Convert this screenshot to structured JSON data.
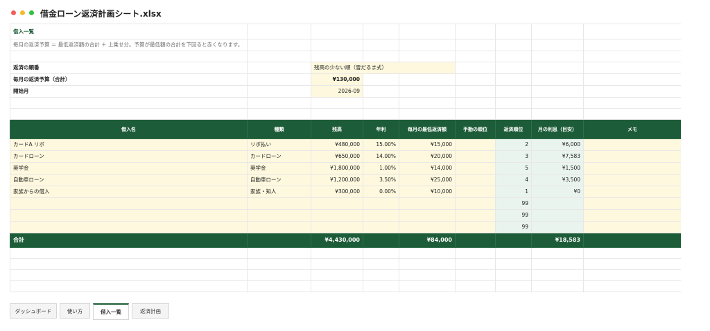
{
  "window": {
    "title": "借金ローン返済計画シート.xlsx"
  },
  "sheet": {
    "title": "借入一覧",
    "note": "毎月の返済予算 ＝ 最低返済額の合計 ＋ 上乗せ分。予算が最低額の合計を下回ると赤くなります。",
    "settings": [
      {
        "label": "返済の順番",
        "value": "残高の少ない順（雪だるま式）"
      },
      {
        "label": "毎月の返済予算（合計）",
        "value": "¥130,000"
      },
      {
        "label": "開始月",
        "value": "2026-09"
      }
    ],
    "headers": [
      "借入名",
      "種類",
      "残高",
      "年利",
      "毎月の最低返済額",
      "手動の順位",
      "返済順位",
      "月の利息（目安）",
      "メモ"
    ],
    "rows": [
      {
        "name": "カードA リボ",
        "kind": "リボ払い",
        "balance": "¥480,000",
        "rate": "15.00%",
        "min": "¥15,000",
        "manual": "",
        "order": "2",
        "interest": "¥6,000",
        "memo": ""
      },
      {
        "name": "カードローン",
        "kind": "カードローン",
        "balance": "¥650,000",
        "rate": "14.00%",
        "min": "¥20,000",
        "manual": "",
        "order": "3",
        "interest": "¥7,583",
        "memo": ""
      },
      {
        "name": "奨学金",
        "kind": "奨学金",
        "balance": "¥1,800,000",
        "rate": "1.00%",
        "min": "¥14,000",
        "manual": "",
        "order": "5",
        "interest": "¥1,500",
        "memo": ""
      },
      {
        "name": "自動車ローン",
        "kind": "自動車ローン",
        "balance": "¥1,200,000",
        "rate": "3.50%",
        "min": "¥25,000",
        "manual": "",
        "order": "4",
        "interest": "¥3,500",
        "memo": ""
      },
      {
        "name": "家族からの借入",
        "kind": "家族・知人",
        "balance": "¥300,000",
        "rate": "0.00%",
        "min": "¥10,000",
        "manual": "",
        "order": "1",
        "interest": "¥0",
        "memo": ""
      },
      {
        "name": "",
        "kind": "",
        "balance": "",
        "rate": "",
        "min": "",
        "manual": "",
        "order": "99",
        "interest": "",
        "memo": ""
      },
      {
        "name": "",
        "kind": "",
        "balance": "",
        "rate": "",
        "min": "",
        "manual": "",
        "order": "99",
        "interest": "",
        "memo": ""
      },
      {
        "name": "",
        "kind": "",
        "balance": "",
        "rate": "",
        "min": "",
        "manual": "",
        "order": "99",
        "interest": "",
        "memo": ""
      }
    ],
    "total": {
      "label": "合計",
      "balance": "¥4,430,000",
      "min": "¥84,000",
      "interest": "¥18,583"
    }
  },
  "tabs": [
    "ダッシュボード",
    "使い方",
    "借入一覧",
    "返済計画"
  ],
  "active_tab": "借入一覧",
  "colors": {
    "header_green": "#1d5c38",
    "input_cream": "#fdf8de",
    "calc_mint": "#eaf4ee"
  }
}
